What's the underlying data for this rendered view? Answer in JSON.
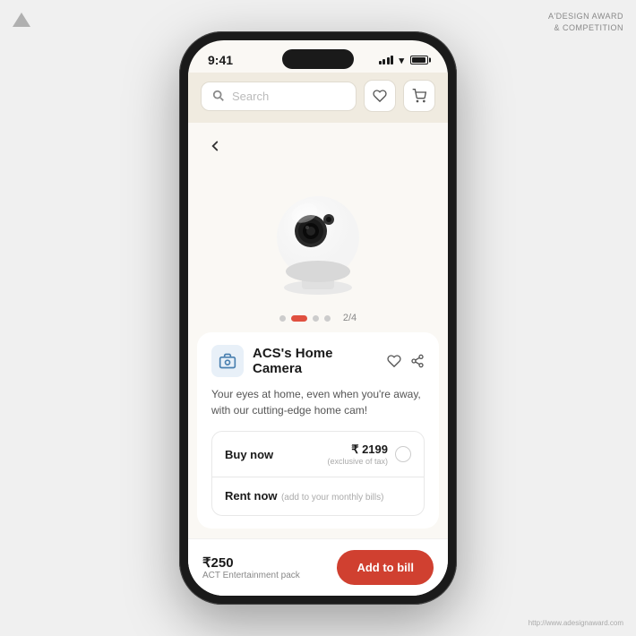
{
  "adesign": {
    "line1": "A'DESIGN AWARD",
    "line2": "& COMPETITION",
    "url": "http://www.adesignaward.com"
  },
  "status_bar": {
    "time": "9:41",
    "signal": "signal",
    "wifi": "wifi",
    "battery": "battery"
  },
  "search": {
    "placeholder": "Search",
    "wishlist_icon": "♡",
    "cart_icon": "🛒"
  },
  "product": {
    "title": "ACS's Home Camera",
    "description": "Your eyes at home, even when you're away, with our cutting-edge home cam!",
    "pagination": "2/4",
    "buy_label": "Buy now",
    "buy_price": "₹ 2199",
    "buy_price_note": "(exclusive of tax)",
    "rent_label": "Rent now",
    "rent_note": "(add to your monthly bills)"
  },
  "bottom_bar": {
    "price": "₹250",
    "label": "ACT Entertainment pack",
    "button": "Add to bill"
  }
}
